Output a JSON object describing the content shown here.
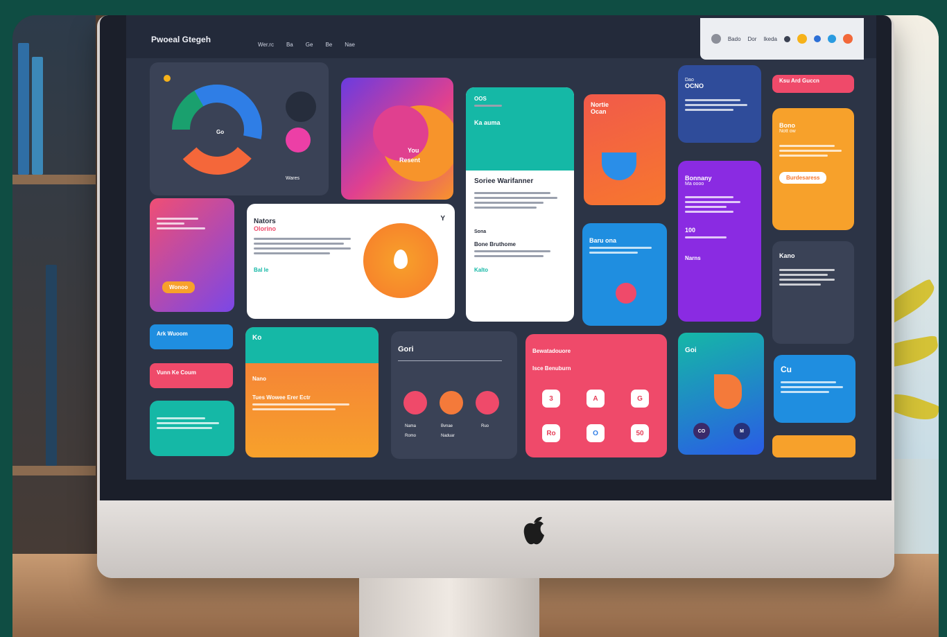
{
  "header": {
    "title": "Pwoeal Gtegeh",
    "nav": [
      "Wer.rc",
      "Ba",
      "Ge",
      "Be",
      "Nae"
    ],
    "right_items": [
      "Bado",
      "Dor",
      "Ikeda"
    ]
  },
  "cards": {
    "ring_card": {
      "center": "Go",
      "caption": "Wares"
    },
    "gradient_card": {
      "line1": "You",
      "line2": "Resent"
    },
    "teal_card": {
      "top": "OOS",
      "sub": "Ka auma",
      "heading": "Soriee Warifanner",
      "sub2": "Sona",
      "sub3": "Bone Bruthome",
      "link": "Kalto"
    },
    "orange_red_card": {
      "line1": "Nortie",
      "line2": "Ocan"
    },
    "navy_card": {
      "line1": "Dao",
      "line2": "OCNO"
    },
    "pill_red": "Ksu Ard Guccn",
    "orange_tall": {
      "line1": "Bono",
      "line2": "Nott ow",
      "button": "Burdesaress"
    },
    "pink_card": {
      "button": "Wonoo"
    },
    "white_card": {
      "title": "Nators",
      "sub": "Olorino",
      "link": "Bal le",
      "icon_letter": "Y"
    },
    "blue_mid_card": {
      "title": "Baru ona"
    },
    "purple_card": {
      "title": "Bonnany",
      "sub": "Ma oooo",
      "number": "100",
      "footer": "Narns"
    },
    "gray_right_card": {
      "title": "Kano"
    },
    "blue_pill": "Ark Wuoom",
    "pink_pill": "Vunn Ke Coum",
    "orange_bottom": {
      "badge": "Ko",
      "label": "Nano",
      "text": "Tues Wowee Erer Ectr"
    },
    "dark_bottom": {
      "title": "Gori",
      "labels": [
        "Nama",
        "Bvnae",
        "Ruo"
      ],
      "sub": [
        "Romo",
        "Naduar"
      ]
    },
    "pink_bottom": {
      "title": "Bewatadouore",
      "sub": "Isce Benuburn",
      "tiles": [
        "3",
        "A",
        "G",
        "Ro",
        "O",
        "50"
      ]
    },
    "teal_blue_bottom": {
      "title": "Goi",
      "btns": [
        "CO",
        "M"
      ]
    },
    "blue_right_bottom": {
      "title": "Cu"
    }
  },
  "colors": {
    "screen": "#2c3446",
    "orange": "#f7a12b",
    "pink": "#ef4a6a",
    "teal": "#15b8a6",
    "purple": "#8a2be2",
    "blue": "#1f8ee0"
  }
}
